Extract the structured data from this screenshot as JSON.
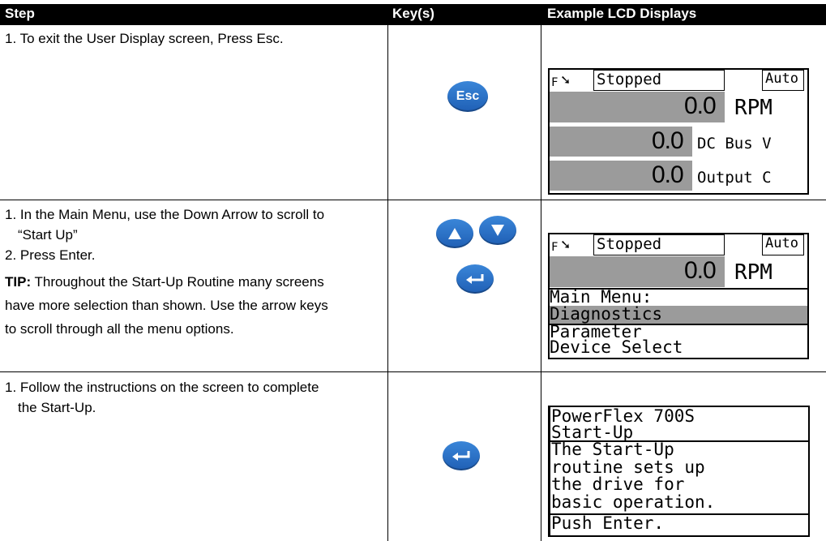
{
  "header": {
    "step": "Step",
    "keys": "Key(s)",
    "lcd": "Example LCD Displays"
  },
  "rows": [
    {
      "lines": [
        "1. To exit the User Display screen, Press Esc."
      ],
      "keys": [
        "Esc"
      ],
      "lcd": {
        "direction": "F",
        "status": "Stopped",
        "mode": "Auto",
        "lines": [
          {
            "value": "0.0",
            "unit": "RPM"
          },
          {
            "value": "0.0",
            "unit": "DC Bus V"
          },
          {
            "value": "0.0",
            "unit": "Output C"
          }
        ]
      }
    },
    {
      "lines": [
        "1. In the Main Menu, use the Down Arrow to scroll to",
        "“Start Up”",
        "2. Press Enter."
      ],
      "tip_label": "TIP:",
      "tip_lines": [
        " Throughout the Start-Up Routine many screens",
        "have more selection than shown. Use the arrow keys",
        "to scroll through all the menu options."
      ],
      "lcd": {
        "direction": "F",
        "status": "Stopped",
        "mode": "Auto",
        "value": "0.0",
        "unit": "RPM",
        "menu_title": "Main Menu:",
        "menu_items": [
          "Diagnostics",
          "Parameter",
          "Device Select"
        ]
      }
    },
    {
      "lines": [
        "1. Follow the instructions on the screen to complete",
        "the Start-Up."
      ],
      "lcd": {
        "title_lines": [
          "PowerFlex 700S",
          "Start-Up"
        ],
        "body_lines": [
          "The Start-Up",
          "routine sets up",
          "the drive for",
          "basic operation.",
          "Push Enter."
        ]
      }
    }
  ]
}
